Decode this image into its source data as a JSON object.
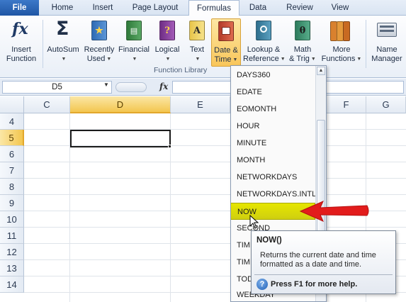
{
  "ribbon_tabs": [
    {
      "label": "File"
    },
    {
      "label": "Home"
    },
    {
      "label": "Insert"
    },
    {
      "label": "Page Layout"
    },
    {
      "label": "Formulas"
    },
    {
      "label": "Data"
    },
    {
      "label": "Review"
    },
    {
      "label": "View"
    }
  ],
  "ribbon": {
    "insert_function": {
      "line1": "Insert",
      "line2": "Function",
      "icon": "fx-icon"
    },
    "autosum": {
      "line1": "AutoSum",
      "icon": "sigma-icon"
    },
    "recently_used": {
      "line1": "Recently",
      "line2": "Used",
      "icon": "star-book-icon"
    },
    "financial": {
      "line1": "Financial",
      "icon": "money-book-icon"
    },
    "logical": {
      "line1": "Logical",
      "icon": "question-book-icon"
    },
    "text": {
      "line1": "Text",
      "icon": "text-book-icon"
    },
    "date_time": {
      "line1": "Date &",
      "line2": "Time",
      "icon": "calendar-book-icon"
    },
    "lookup": {
      "line1": "Lookup &",
      "line2": "Reference",
      "icon": "magnifier-book-icon"
    },
    "math": {
      "line1": "Math",
      "line2": "& Trig",
      "icon": "theta-book-icon"
    },
    "more": {
      "line1": "More",
      "line2": "Functions",
      "icon": "stack-books-icon"
    },
    "name_manager": {
      "line1": "Name",
      "line2": "Manager",
      "icon": "address-book-icon"
    },
    "group_label": "Function Library",
    "fx_glyph": "fx",
    "sigma_glyph": "Σ",
    "question_glyph": "?",
    "text_glyph": "A",
    "theta_glyph": "θ"
  },
  "formula_bar": {
    "name_box": "D5",
    "fx_label": "fx",
    "formula": ""
  },
  "grid": {
    "columns": [
      "C",
      "D",
      "E",
      "F",
      "G"
    ],
    "rows": [
      "4",
      "5",
      "6",
      "7",
      "8",
      "9",
      "10",
      "11",
      "12",
      "13",
      "14"
    ],
    "selected_column": "D",
    "selected_row": "5",
    "active_cell": "D5"
  },
  "dropdown": {
    "items": [
      "DAYS360",
      "EDATE",
      "EOMONTH",
      "HOUR",
      "MINUTE",
      "MONTH",
      "NETWORKDAYS",
      "NETWORKDAYS.INTL",
      "NOW",
      "SECOND",
      "TIME",
      "TIME",
      "TOD",
      "WEEKDAY"
    ],
    "highlighted": "NOW"
  },
  "tooltip": {
    "title": "NOW()",
    "description": "Returns the current date and time formatted as a date and time.",
    "help_text": "Press F1 for more help.",
    "help_glyph": "?"
  },
  "colors": {
    "file_tab": "#2a63b4",
    "pressed_button": "#f9c65a",
    "selected_header": "#f3c64f",
    "highlight_item": "#dcdc00",
    "arrow": "#e21c1c"
  }
}
